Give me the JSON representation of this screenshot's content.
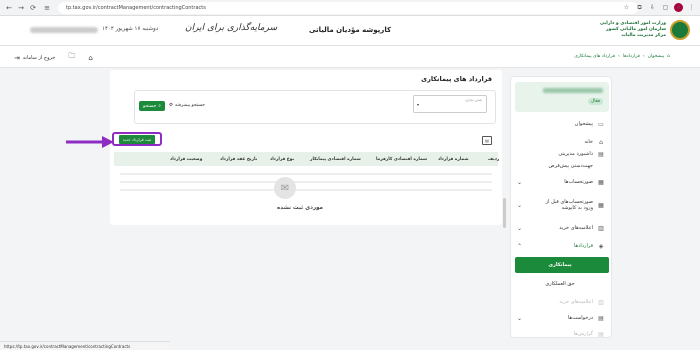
{
  "browser": {
    "url": "tp.tax.gov.ir/contractManagement/contractingContracts",
    "status_url": "https://tp.tax.gov.ir/contractManagement/contractingContracts",
    "profile_initial": "A"
  },
  "banner": {
    "title": "کارپوشه مؤدیان مالیاتی",
    "date": "دوشنبه ۱۷ شهریور ۱۴۰۴",
    "org_line1": "وزارت امور اقتصادی و دارایی",
    "org_line2": "سازمان امور مالیاتی کشور",
    "org_line3": "مرکز مدیریت مالیات",
    "calligraphy": "سرمایه‌گذاری برای ایران"
  },
  "subbar": {
    "breadcrumb": [
      "پیشخوان",
      "قراردادها",
      "قرارداد های پیمانکاری"
    ],
    "exit_label": "خروج از سامانه"
  },
  "sidebar": {
    "active_badge": "فعال",
    "items": [
      {
        "label": "پیشخوان",
        "icon": "dashboard-icon"
      },
      {
        "label": "خانه",
        "icon": "home-icon"
      },
      {
        "label": "داشبورد مدیریتی",
        "icon": "chart-icon"
      },
      {
        "label": "جهت‌دستی پیش‌فرض",
        "icon": "doc-icon"
      },
      {
        "label": "صورتحساب‌ها",
        "icon": "invoice-icon"
      },
      {
        "label": "صورتحساب‌های قبل از ورود به کاپوشه",
        "icon": "invoice2-icon"
      },
      {
        "label": "اعلامیه‌های خرید",
        "icon": "purchase-icon"
      },
      {
        "label": "قراردادها",
        "icon": "contract-icon"
      },
      {
        "label": "پیمانکاری",
        "icon": ""
      },
      {
        "label": "حق العملکاری",
        "icon": ""
      },
      {
        "label": "اعلامیه‌های خرید",
        "icon": "purchase-icon"
      },
      {
        "label": "درخواست‌ها",
        "icon": "request-icon"
      },
      {
        "label": "گزارش‌ها",
        "icon": "report-icon"
      }
    ]
  },
  "main": {
    "title": "قرارداد های پیمانکاری",
    "select_label": "نقش تجاری",
    "search_label": "جستجو",
    "advanced_search": "جستجو پیشرفته",
    "register_button": "ثبت قرارداد جدید",
    "columns": [
      "ردیف",
      "شماره قرارداد",
      "شماره اقتصادی کارفرما",
      "شماره اقتصادی پیمانکار",
      "نوع قرارداد",
      "تاریخ عقد قرارداد",
      "وضعیت قرارداد"
    ],
    "empty_text": "موردی ثبت نشده"
  },
  "colors": {
    "brand": "#1b8a3a",
    "highlight": "#8e2cc4"
  }
}
